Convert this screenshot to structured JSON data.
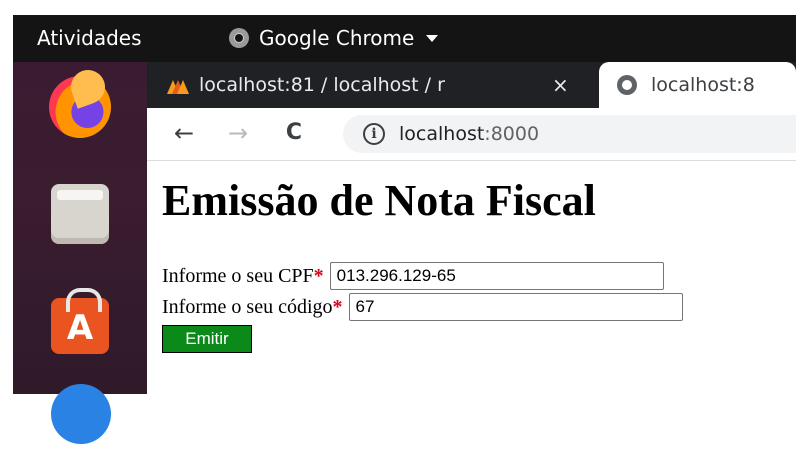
{
  "topbar": {
    "activities_label": "Atividades",
    "app_label": "Google Chrome"
  },
  "dock": {
    "items": [
      "firefox-icon",
      "files-icon",
      "software-store-icon",
      "help-icon"
    ]
  },
  "browser": {
    "tabs": [
      {
        "title": "localhost:81 / localhost / r",
        "close": "×",
        "icon": "phpmyadmin-icon"
      },
      {
        "title": "localhost:8",
        "icon": "globe-icon"
      }
    ],
    "toolbar": {
      "back": "←",
      "forward": "→",
      "reload": "C",
      "info_icon": "i",
      "url_host": "localhost",
      "url_port": ":8000"
    }
  },
  "page": {
    "title": "Emissão de Nota Fiscal",
    "cpf_label": "Informe o seu CPF",
    "cpf_value": "013.296.129-65",
    "codigo_label": "Informe o seu código",
    "codigo_value": "67",
    "required_marker": "*",
    "submit_label": "Emitir"
  },
  "colors": {
    "required": "#d8001b",
    "button": "#0b8a1a",
    "dock": "#3b1b31",
    "topbar": "#141414"
  }
}
